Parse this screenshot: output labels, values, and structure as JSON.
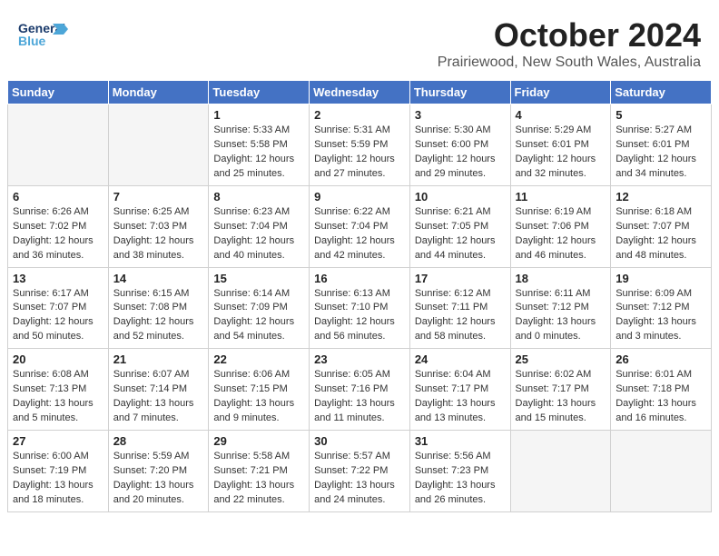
{
  "header": {
    "logo_general": "General",
    "logo_blue": "Blue",
    "month": "October 2024",
    "location": "Prairiewood, New South Wales, Australia"
  },
  "weekdays": [
    "Sunday",
    "Monday",
    "Tuesday",
    "Wednesday",
    "Thursday",
    "Friday",
    "Saturday"
  ],
  "weeks": [
    [
      {
        "day": "",
        "details": ""
      },
      {
        "day": "",
        "details": ""
      },
      {
        "day": "1",
        "details": "Sunrise: 5:33 AM\nSunset: 5:58 PM\nDaylight: 12 hours\nand 25 minutes."
      },
      {
        "day": "2",
        "details": "Sunrise: 5:31 AM\nSunset: 5:59 PM\nDaylight: 12 hours\nand 27 minutes."
      },
      {
        "day": "3",
        "details": "Sunrise: 5:30 AM\nSunset: 6:00 PM\nDaylight: 12 hours\nand 29 minutes."
      },
      {
        "day": "4",
        "details": "Sunrise: 5:29 AM\nSunset: 6:01 PM\nDaylight: 12 hours\nand 32 minutes."
      },
      {
        "day": "5",
        "details": "Sunrise: 5:27 AM\nSunset: 6:01 PM\nDaylight: 12 hours\nand 34 minutes."
      }
    ],
    [
      {
        "day": "6",
        "details": "Sunrise: 6:26 AM\nSunset: 7:02 PM\nDaylight: 12 hours\nand 36 minutes."
      },
      {
        "day": "7",
        "details": "Sunrise: 6:25 AM\nSunset: 7:03 PM\nDaylight: 12 hours\nand 38 minutes."
      },
      {
        "day": "8",
        "details": "Sunrise: 6:23 AM\nSunset: 7:04 PM\nDaylight: 12 hours\nand 40 minutes."
      },
      {
        "day": "9",
        "details": "Sunrise: 6:22 AM\nSunset: 7:04 PM\nDaylight: 12 hours\nand 42 minutes."
      },
      {
        "day": "10",
        "details": "Sunrise: 6:21 AM\nSunset: 7:05 PM\nDaylight: 12 hours\nand 44 minutes."
      },
      {
        "day": "11",
        "details": "Sunrise: 6:19 AM\nSunset: 7:06 PM\nDaylight: 12 hours\nand 46 minutes."
      },
      {
        "day": "12",
        "details": "Sunrise: 6:18 AM\nSunset: 7:07 PM\nDaylight: 12 hours\nand 48 minutes."
      }
    ],
    [
      {
        "day": "13",
        "details": "Sunrise: 6:17 AM\nSunset: 7:07 PM\nDaylight: 12 hours\nand 50 minutes."
      },
      {
        "day": "14",
        "details": "Sunrise: 6:15 AM\nSunset: 7:08 PM\nDaylight: 12 hours\nand 52 minutes."
      },
      {
        "day": "15",
        "details": "Sunrise: 6:14 AM\nSunset: 7:09 PM\nDaylight: 12 hours\nand 54 minutes."
      },
      {
        "day": "16",
        "details": "Sunrise: 6:13 AM\nSunset: 7:10 PM\nDaylight: 12 hours\nand 56 minutes."
      },
      {
        "day": "17",
        "details": "Sunrise: 6:12 AM\nSunset: 7:11 PM\nDaylight: 12 hours\nand 58 minutes."
      },
      {
        "day": "18",
        "details": "Sunrise: 6:11 AM\nSunset: 7:12 PM\nDaylight: 13 hours\nand 0 minutes."
      },
      {
        "day": "19",
        "details": "Sunrise: 6:09 AM\nSunset: 7:12 PM\nDaylight: 13 hours\nand 3 minutes."
      }
    ],
    [
      {
        "day": "20",
        "details": "Sunrise: 6:08 AM\nSunset: 7:13 PM\nDaylight: 13 hours\nand 5 minutes."
      },
      {
        "day": "21",
        "details": "Sunrise: 6:07 AM\nSunset: 7:14 PM\nDaylight: 13 hours\nand 7 minutes."
      },
      {
        "day": "22",
        "details": "Sunrise: 6:06 AM\nSunset: 7:15 PM\nDaylight: 13 hours\nand 9 minutes."
      },
      {
        "day": "23",
        "details": "Sunrise: 6:05 AM\nSunset: 7:16 PM\nDaylight: 13 hours\nand 11 minutes."
      },
      {
        "day": "24",
        "details": "Sunrise: 6:04 AM\nSunset: 7:17 PM\nDaylight: 13 hours\nand 13 minutes."
      },
      {
        "day": "25",
        "details": "Sunrise: 6:02 AM\nSunset: 7:17 PM\nDaylight: 13 hours\nand 15 minutes."
      },
      {
        "day": "26",
        "details": "Sunrise: 6:01 AM\nSunset: 7:18 PM\nDaylight: 13 hours\nand 16 minutes."
      }
    ],
    [
      {
        "day": "27",
        "details": "Sunrise: 6:00 AM\nSunset: 7:19 PM\nDaylight: 13 hours\nand 18 minutes."
      },
      {
        "day": "28",
        "details": "Sunrise: 5:59 AM\nSunset: 7:20 PM\nDaylight: 13 hours\nand 20 minutes."
      },
      {
        "day": "29",
        "details": "Sunrise: 5:58 AM\nSunset: 7:21 PM\nDaylight: 13 hours\nand 22 minutes."
      },
      {
        "day": "30",
        "details": "Sunrise: 5:57 AM\nSunset: 7:22 PM\nDaylight: 13 hours\nand 24 minutes."
      },
      {
        "day": "31",
        "details": "Sunrise: 5:56 AM\nSunset: 7:23 PM\nDaylight: 13 hours\nand 26 minutes."
      },
      {
        "day": "",
        "details": ""
      },
      {
        "day": "",
        "details": ""
      }
    ]
  ]
}
